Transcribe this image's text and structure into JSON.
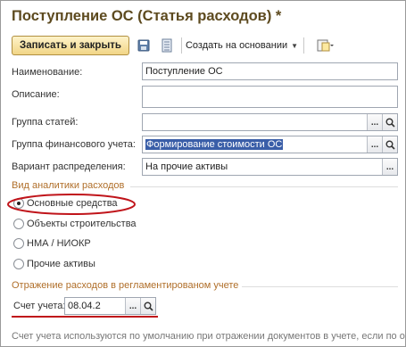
{
  "window": {
    "title": "Поступление ОС (Статья расходов) *"
  },
  "toolbar": {
    "save_close_label": "Записать и закрыть",
    "create_based_label": "Создать на основании",
    "icons": [
      "save-icon",
      "list-icon",
      "attach-icon"
    ]
  },
  "form": {
    "name": {
      "label": "Наименование:",
      "value": "Поступление ОС"
    },
    "description": {
      "label": "Описание:",
      "value": ""
    },
    "item_group": {
      "label": "Группа статей:",
      "value": "",
      "btn": "..."
    },
    "financial_group": {
      "label": "Группа финансового учета:",
      "value": "Формирование стоимости ОС",
      "btn": "..."
    },
    "distribution": {
      "label": "Вариант распределения:",
      "value": "На прочие активы",
      "btn": "..."
    }
  },
  "analytics": {
    "header": "Вид аналитики расходов",
    "options": [
      {
        "label": "Основные средства",
        "selected": true
      },
      {
        "label": "Объекты строительства",
        "selected": false
      },
      {
        "label": "НМА / НИОКР",
        "selected": false
      },
      {
        "label": "Прочие активы",
        "selected": false
      }
    ]
  },
  "regulated": {
    "header": "Отражение расходов в регламентированом учете",
    "account_label": "Счет учета:",
    "account_value": "08.04.2",
    "btn": "..."
  },
  "hint": "Счет учета используются по умолчанию при отражении документов в учете, если по ор",
  "colors": {
    "title": "#5d4a1f",
    "section": "#b06f2a",
    "highlight_ellipse": "#c0141a",
    "selection": "#3a5ea8"
  }
}
